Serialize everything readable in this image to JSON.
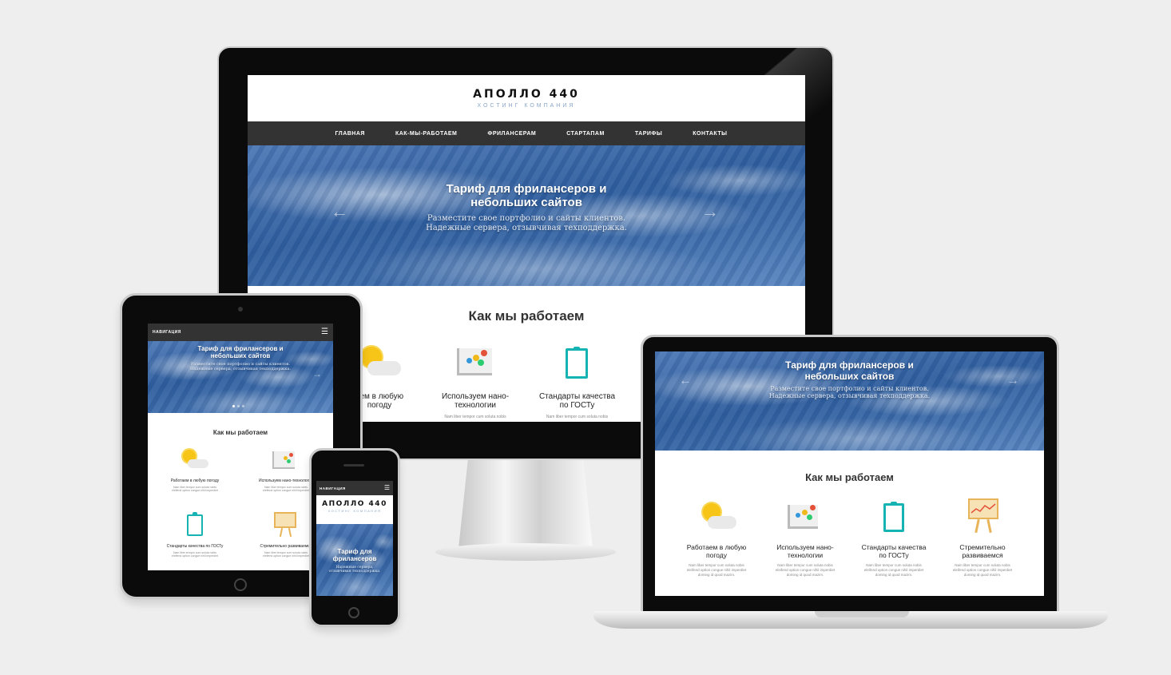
{
  "site": {
    "brand": "АПОЛЛО 440",
    "tagline": "ХОСТИНГ КОМПАНИЯ",
    "nav": [
      "ГЛАВНАЯ",
      "КАК-МЫ-РАБОТАЕМ",
      "ФРИЛАНСЕРАМ",
      "СТАРТАПАМ",
      "ТАРИФЫ",
      "КОНТАКТЫ"
    ],
    "nav_mobile_label": "НАВИГАЦИЯ",
    "hero_title_line1": "Тариф для фрилансеров и",
    "hero_title_line2": "небольших сайтов",
    "hero_sub_line1": "Разместите свое портфолио и сайты клиентов.",
    "hero_sub_line2": "Надежные сервера, отзывчивая техподдержка.",
    "phone_hero_title_line1": "Тариф для",
    "phone_hero_title_line2": "фрилансеров",
    "phone_hero_sub_line1": "Надежные сервера,",
    "phone_hero_sub_line2": "отзывчивая техподдержка.",
    "section_title": "Как мы работаем",
    "features": [
      {
        "title_line1": "Работаем в любую",
        "title_line2": "погоду",
        "icon": "weather-icon"
      },
      {
        "title_line1": "Используем нано-",
        "title_line2": "технологии",
        "icon": "nano-icon"
      },
      {
        "title_line1": "Стандарты качества",
        "title_line2": "по ГОСТу",
        "icon": "clipboard-icon"
      },
      {
        "title_line1": "Стремительно",
        "title_line2": "развиваемся",
        "icon": "easel-chart-icon"
      }
    ],
    "features_tablet": [
      "Работаем в любую погоду",
      "Используем нано-технологии",
      "Стандарты качества по ГОСТу",
      "Стремительно развиваемся"
    ],
    "feature_text_line1": "Nam liber tempor cum soluta nobis",
    "feature_text_line2": "eleifend option congue nihil imperdiet",
    "feature_text_line3": "doming id quod mazim.",
    "feature_text_monitor_line1": "Nam liber tempor cum soluta nobis",
    "feature_text_monitor_line2": "eleifend option congue nihil imperdiet",
    "feature_text_monitor_line3": "doming id quod mazim.",
    "monitor_feature_titles": [
      {
        "line1": "Работаем в любую",
        "line2": "погоду"
      },
      {
        "line1": "Используем нано-",
        "line2": "технологии"
      },
      {
        "line1": "Стандарты качества",
        "line2": "по ГОСТу"
      }
    ],
    "monitor_partial_title_line1": "аем в любую",
    "monitor_partial_title_line2": "погоду"
  },
  "colors": {
    "navbar": "#333334",
    "hero_blue": "#2f5e9e",
    "accent_teal": "#16b3b3",
    "sun": "#f7c518",
    "background": "#eeeeee"
  }
}
